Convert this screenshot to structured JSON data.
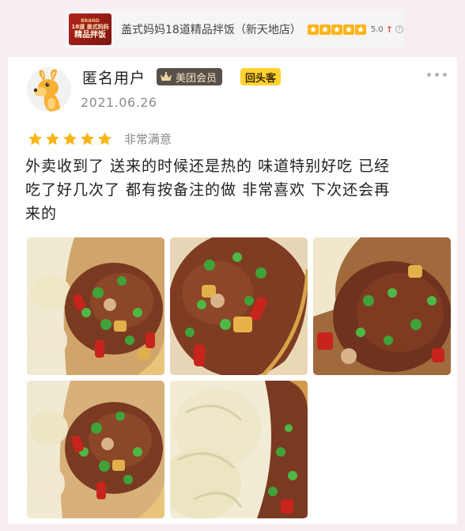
{
  "shop": {
    "thumb_line1": "BRAND",
    "thumb_line2": "18道 盖式妈妈",
    "thumb_line3": "精品拌饭",
    "name": "盖式妈妈18道精品拌饭（新天地店）",
    "rating": "5.0",
    "trend_icon": "up-arrow-icon",
    "help_icon": "question-circle-icon",
    "star_color": "#fbb417"
  },
  "review": {
    "avatar_icon": "kangaroo-avatar-icon",
    "user_name": "匿名用户",
    "vip_badge": "美团会员",
    "repeat_badge": "回头客",
    "date": "2021.06.26",
    "stars": 5,
    "rating_label": "非常满意",
    "text_line1": "外卖收到了  送来的时候还是热的  味道特别好吃  已经",
    "text_line2": "吃了好几次了  都有按备注的做  非常喜欢  下次还会再",
    "text_line3": "来的",
    "photos": [
      "food-photo-1",
      "food-photo-2",
      "food-photo-3",
      "food-photo-4",
      "food-photo-5"
    ],
    "accent_colors": {
      "badge_dark": "#58504a",
      "badge_yellow": "#ffd22e",
      "star": "#fbb417"
    }
  }
}
